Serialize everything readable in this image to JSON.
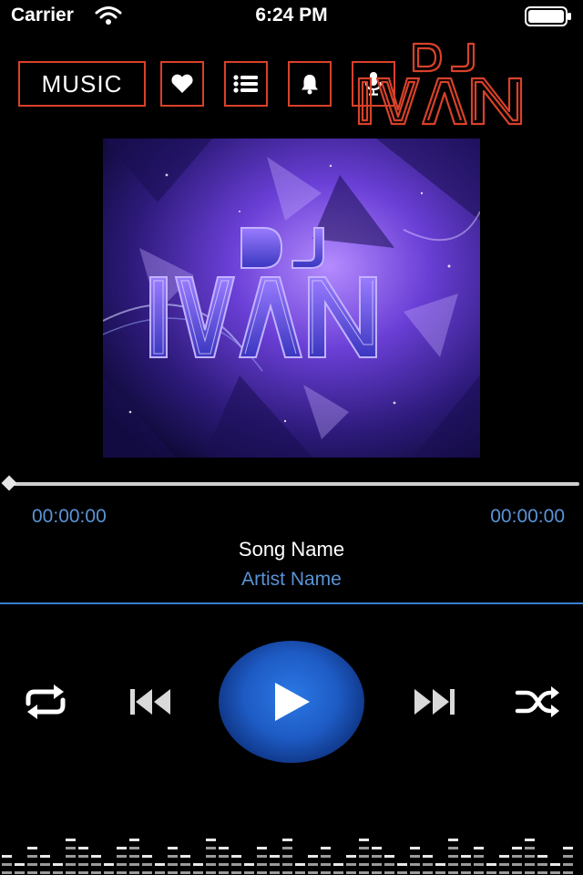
{
  "status_bar": {
    "carrier": "Carrier",
    "time": "6:24 PM"
  },
  "nav": {
    "music_label": "MUSIC",
    "icons": [
      "heart-icon",
      "list-icon",
      "bell-icon",
      "microphone-icon"
    ]
  },
  "logo": {
    "line1": "DJ",
    "line2": "IVAN"
  },
  "album_art": {
    "line1": "DJ",
    "line2": "IVAN"
  },
  "player": {
    "current_time": "00:00:00",
    "total_time": "00:00:00",
    "progress": 0,
    "song_name": "Song Name",
    "artist_name": "Artist Name"
  },
  "controls": [
    "repeat-icon",
    "previous-icon",
    "play-icon",
    "next-icon",
    "shuffle-icon"
  ],
  "colors": {
    "background": "#000000",
    "accent_red": "#d8412a",
    "accent_blue": "#3c7ed0",
    "text_blue": "#5a93d6",
    "play_button": "#1e5bc4"
  }
}
